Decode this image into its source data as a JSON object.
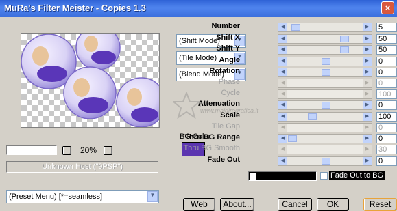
{
  "window": {
    "title": "MuRa's Filter Meister - Copies 1.3",
    "close_glyph": "×"
  },
  "zoom": {
    "value": "20%",
    "plus": "+",
    "minus": "−"
  },
  "status_text": "Unknown Host (\"9PSP\")",
  "mode_dropdowns": [
    "(Shift Mode)",
    "(Tile Mode)",
    "(Blend Mode)"
  ],
  "bg_color": {
    "label": "BG Color",
    "swatch": "#5b35b0"
  },
  "parameters": [
    {
      "label": "Number",
      "value": "5",
      "enabled": true,
      "bold": true,
      "thumb": 0.05
    },
    {
      "label": "Shift X",
      "value": "50",
      "enabled": true,
      "bold": true,
      "thumb": 0.78
    },
    {
      "label": "Shift Y",
      "value": "50",
      "enabled": true,
      "bold": true,
      "thumb": 0.78
    },
    {
      "label": "Angle",
      "value": "0",
      "enabled": true,
      "bold": true,
      "thumb": 0.5
    },
    {
      "label": "Rotation",
      "value": "0",
      "enabled": true,
      "bold": true,
      "thumb": 0.5
    },
    {
      "label": "Phase",
      "value": "0",
      "enabled": false,
      "bold": false,
      "thumb": 0.0
    },
    {
      "label": "Cycle",
      "value": "100",
      "enabled": false,
      "bold": false,
      "thumb": 0.0
    },
    {
      "label": "Attenuation",
      "value": "0",
      "enabled": true,
      "bold": true,
      "thumb": 0.5
    },
    {
      "label": "Scale",
      "value": "100",
      "enabled": true,
      "bold": true,
      "thumb": 0.3
    },
    {
      "label": "Tile Gap",
      "value": "0",
      "enabled": false,
      "bold": false,
      "thumb": 0.0
    },
    {
      "label": "Thru BG Range",
      "value": "0",
      "enabled": true,
      "bold": true,
      "thumb": 0.0
    },
    {
      "label": "Thru BG Smooth",
      "value": "30",
      "enabled": false,
      "bold": false,
      "thumb": 0.0
    },
    {
      "label": "Fade Out",
      "value": "0",
      "enabled": true,
      "bold": true,
      "thumb": 0.5
    }
  ],
  "fade_out_to_bg": {
    "label": "Fade Out to BG",
    "checked": false
  },
  "preset_menu": "(Preset Menu)  [*=seamless]",
  "watermark": "pinuccia\nwww.maidiregrafica.it",
  "buttons": {
    "web": "Web",
    "about": "About...",
    "cancel": "Cancel",
    "ok": "OK",
    "reset": "Reset"
  }
}
